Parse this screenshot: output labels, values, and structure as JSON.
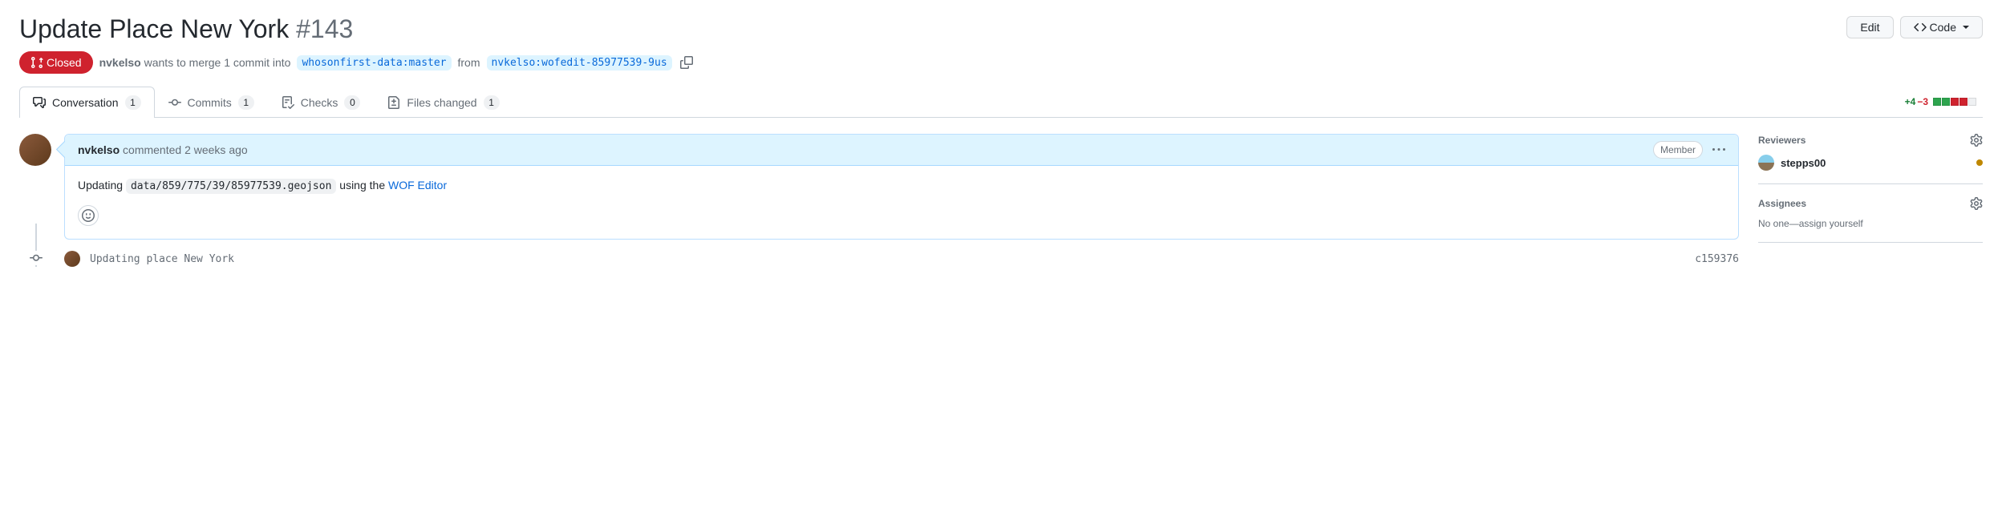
{
  "header": {
    "title": "Update Place New York",
    "number": "#143",
    "edit_label": "Edit",
    "code_label": "Code"
  },
  "meta": {
    "state": "Closed",
    "author": "nvkelso",
    "action_prefix": "wants to merge 1 commit into",
    "base_ref": "whosonfirst-data:master",
    "from_text": "from",
    "head_ref": "nvkelso:wofedit-85977539-9us"
  },
  "tabs": {
    "conversation": {
      "label": "Conversation",
      "count": "1"
    },
    "commits": {
      "label": "Commits",
      "count": "1"
    },
    "checks": {
      "label": "Checks",
      "count": "0"
    },
    "files": {
      "label": "Files changed",
      "count": "1"
    }
  },
  "diffstat": {
    "additions": "+4",
    "deletions": "−3"
  },
  "comment": {
    "author": "nvkelso",
    "verb": "commented",
    "time": "2 weeks ago",
    "badge": "Member",
    "body_prefix": "Updating",
    "body_code": "data/859/775/39/85977539.geojson",
    "body_middle": "using the",
    "body_link": "WOF Editor"
  },
  "commit": {
    "message": "Updating place New York",
    "sha": "c159376"
  },
  "sidebar": {
    "reviewers": {
      "title": "Reviewers",
      "items": [
        {
          "name": "stepps00"
        }
      ]
    },
    "assignees": {
      "title": "Assignees",
      "none_text": "No one—",
      "self_assign": "assign yourself"
    }
  }
}
